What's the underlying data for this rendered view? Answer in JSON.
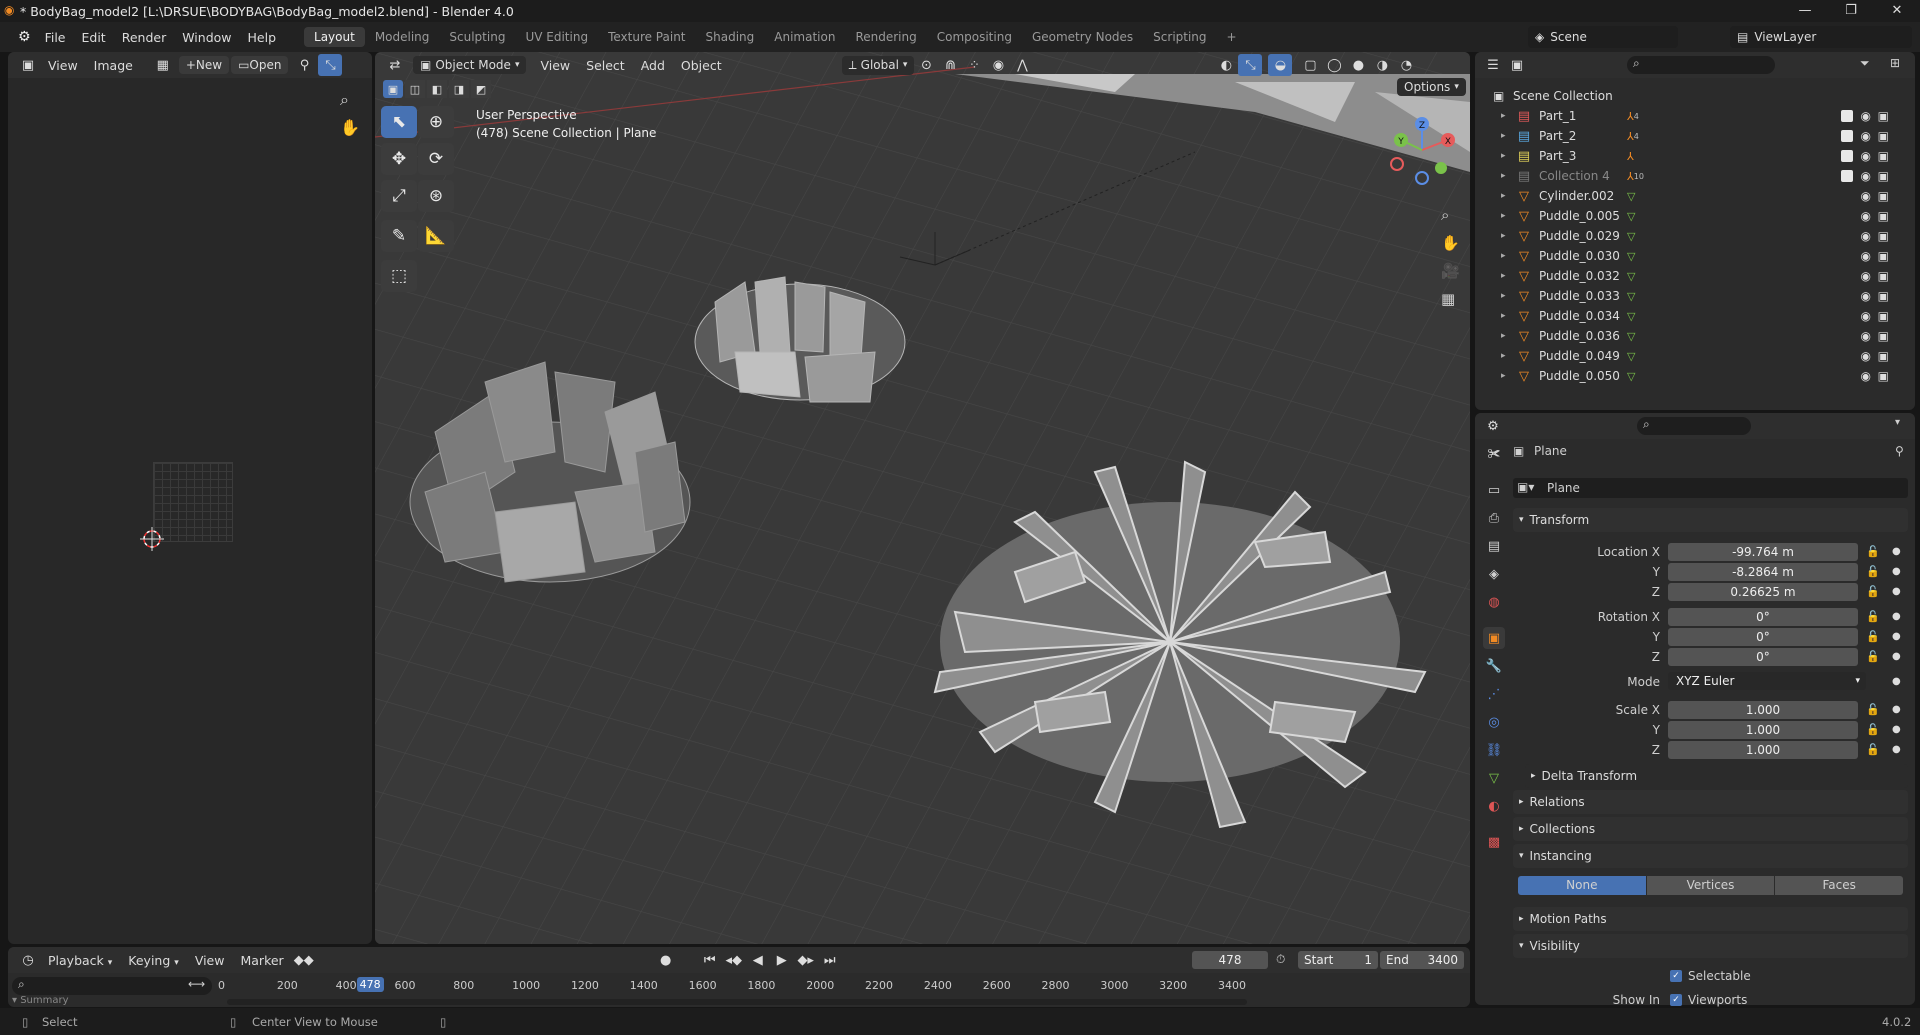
{
  "window": {
    "title": "* BodyBag_model2 [L:\\DRSUE\\BODYBAG\\BodyBag_model2.blend] - Blender 4.0",
    "minimize": "—",
    "maximize": "❐",
    "close": "✕"
  },
  "menus": [
    "File",
    "Edit",
    "Render",
    "Window",
    "Help"
  ],
  "workspaces": [
    "Layout",
    "Modeling",
    "Sculpting",
    "UV Editing",
    "Texture Paint",
    "Shading",
    "Animation",
    "Rendering",
    "Compositing",
    "Geometry Nodes",
    "Scripting"
  ],
  "add_workspace": "+",
  "scene": {
    "name": "Scene",
    "view_layer": "ViewLayer"
  },
  "image_editor": {
    "view": "View",
    "image": "Image",
    "new": "New",
    "open": "Open"
  },
  "viewport": {
    "mode": "Object Mode",
    "view": "View",
    "select": "Select",
    "add": "Add",
    "object": "Object",
    "orientation": "Global",
    "options": "Options",
    "overlay_line1": "User Perspective",
    "overlay_line2": "(478) Scene Collection | Plane",
    "axis_x": "X",
    "axis_y": "Y",
    "axis_z": "Z"
  },
  "outliner": {
    "root": "Scene Collection",
    "items": [
      {
        "name": "Part_1",
        "kind": "collection",
        "color": "#e05a5a",
        "count": "4",
        "checked": true
      },
      {
        "name": "Part_2",
        "kind": "collection",
        "color": "#5aa8e0",
        "count": "4",
        "checked": true
      },
      {
        "name": "Part_3",
        "kind": "collection",
        "color": "#e0d05a",
        "count": "",
        "checked": true
      },
      {
        "name": "Collection 4",
        "kind": "collection",
        "color": "#777777",
        "count": "10",
        "checked": true,
        "dim": true
      },
      {
        "name": "Cylinder.002",
        "kind": "mesh"
      },
      {
        "name": "Puddle_0.005",
        "kind": "mesh"
      },
      {
        "name": "Puddle_0.029",
        "kind": "mesh"
      },
      {
        "name": "Puddle_0.030",
        "kind": "mesh"
      },
      {
        "name": "Puddle_0.032",
        "kind": "mesh"
      },
      {
        "name": "Puddle_0.033",
        "kind": "mesh"
      },
      {
        "name": "Puddle_0.034",
        "kind": "mesh"
      },
      {
        "name": "Puddle_0.036",
        "kind": "mesh"
      },
      {
        "name": "Puddle_0.049",
        "kind": "mesh"
      },
      {
        "name": "Puddle_0.050",
        "kind": "mesh"
      }
    ]
  },
  "properties": {
    "object_name": "Plane",
    "data_name": "Plane",
    "transform": "Transform",
    "location_x_label": "Location X",
    "location_x": "-99.764 m",
    "y_label": "Y",
    "location_y": "-8.2864 m",
    "z_label": "Z",
    "location_z": "0.26625 m",
    "rotation_x_label": "Rotation X",
    "rotation_x": "0°",
    "rotation_y": "0°",
    "rotation_z": "0°",
    "mode_label": "Mode",
    "mode": "XYZ Euler",
    "scale_x_label": "Scale X",
    "scale_x": "1.000",
    "scale_y": "1.000",
    "scale_z": "1.000",
    "delta": "Delta Transform",
    "relations": "Relations",
    "collections": "Collections",
    "instancing": "Instancing",
    "inst_none": "None",
    "inst_vertices": "Vertices",
    "inst_faces": "Faces",
    "motion_paths": "Motion Paths",
    "visibility": "Visibility",
    "selectable": "Selectable",
    "show_in": "Show In",
    "viewports": "Viewports"
  },
  "timeline": {
    "playback": "Playback",
    "keying": "Keying",
    "view": "View",
    "marker": "Marker",
    "current_frame": "478",
    "start_label": "Start",
    "start": "1",
    "end_label": "End",
    "end": "3400",
    "ticks": [
      "0",
      "200",
      "400",
      "600",
      "800",
      "1000",
      "1200",
      "1400",
      "1600",
      "1800",
      "2000",
      "2200",
      "2400",
      "2600",
      "2800",
      "3000",
      "3200",
      "3400"
    ],
    "summary": "Summary"
  },
  "statusbar": {
    "select": "Select",
    "center": "Center View to Mouse",
    "version": "4.0.2"
  }
}
